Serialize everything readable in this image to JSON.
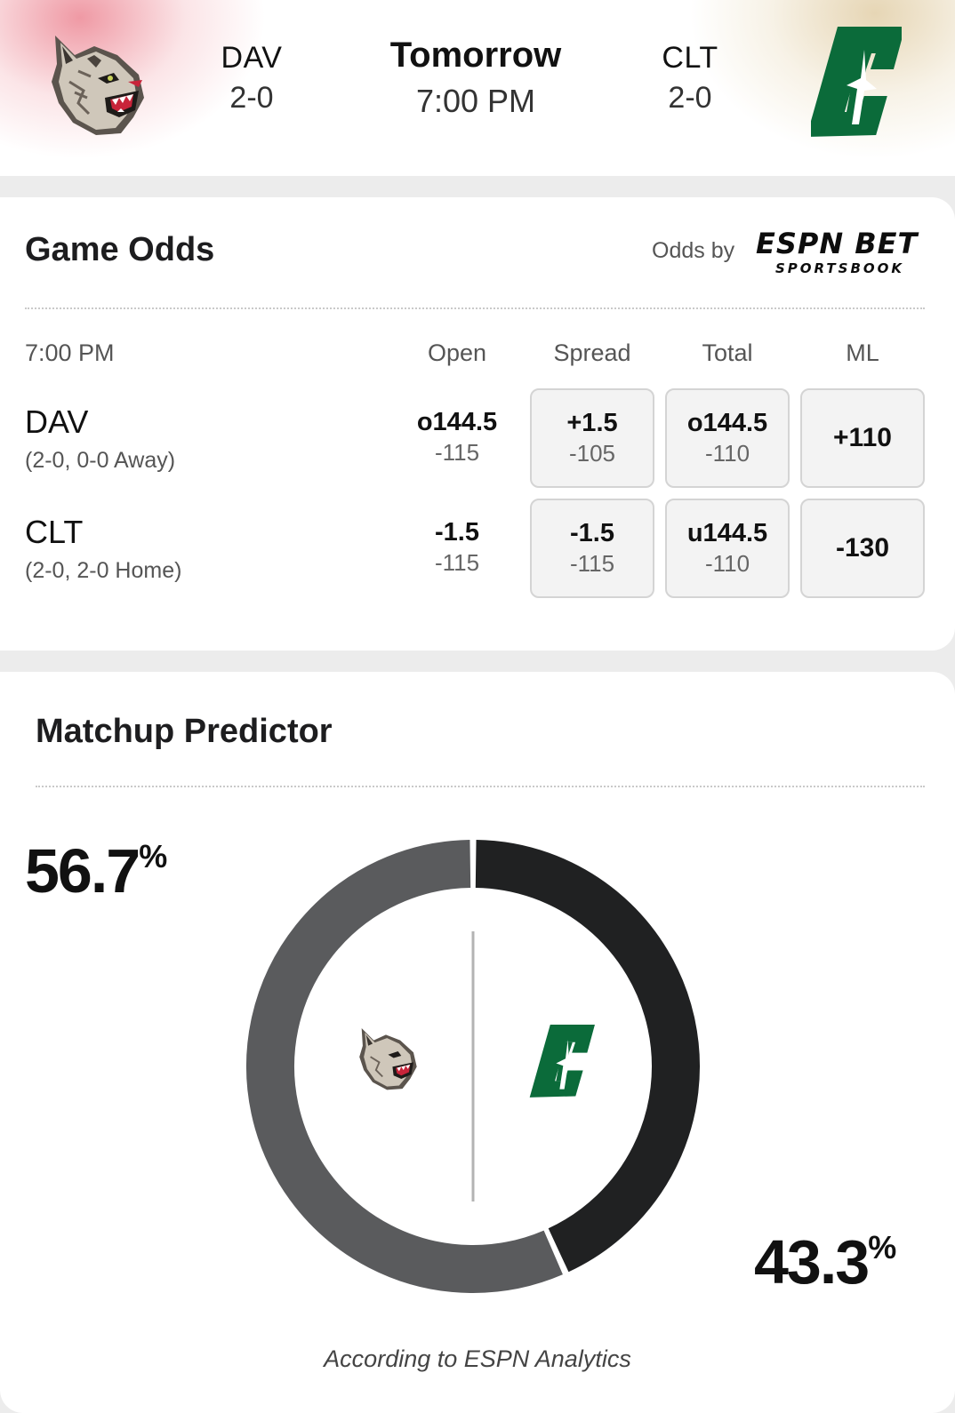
{
  "header": {
    "away": {
      "abbr": "DAV",
      "record": "2-0"
    },
    "home": {
      "abbr": "CLT",
      "record": "2-0"
    },
    "day": "Tomorrow",
    "time": "7:00 PM"
  },
  "odds": {
    "title": "Game Odds",
    "provider_prefix": "Odds by",
    "provider_name": "ESPN BET",
    "provider_sub": "SPORTSBOOK",
    "time_label": "7:00 PM",
    "columns": [
      "Open",
      "Spread",
      "Total",
      "ML"
    ],
    "rows": [
      {
        "team": "DAV",
        "detail": "(2-0, 0-0 Away)",
        "open": {
          "main": "o144.5",
          "sub": "-115"
        },
        "spread": {
          "main": "+1.5",
          "sub": "-105"
        },
        "total": {
          "main": "o144.5",
          "sub": "-110"
        },
        "ml": "+110"
      },
      {
        "team": "CLT",
        "detail": "(2-0, 2-0 Home)",
        "open": {
          "main": "-1.5",
          "sub": "-115"
        },
        "spread": {
          "main": "-1.5",
          "sub": "-115"
        },
        "total": {
          "main": "u144.5",
          "sub": "-110"
        },
        "ml": "-130"
      }
    ]
  },
  "predictor": {
    "title": "Matchup Predictor",
    "away_pct": "56.7",
    "home_pct": "43.3",
    "pct_sign": "%",
    "away_value": 56.7,
    "home_value": 43.3,
    "away_color": "#5a5b5d",
    "home_color": "#202122",
    "note": "According to ESPN Analytics"
  },
  "colors": {
    "clt_green": "#0b6b3a",
    "background": "#ececec"
  },
  "icons": {
    "away_logo": "davidson-wildcat-icon",
    "home_logo": "charlotte-c-icon"
  }
}
